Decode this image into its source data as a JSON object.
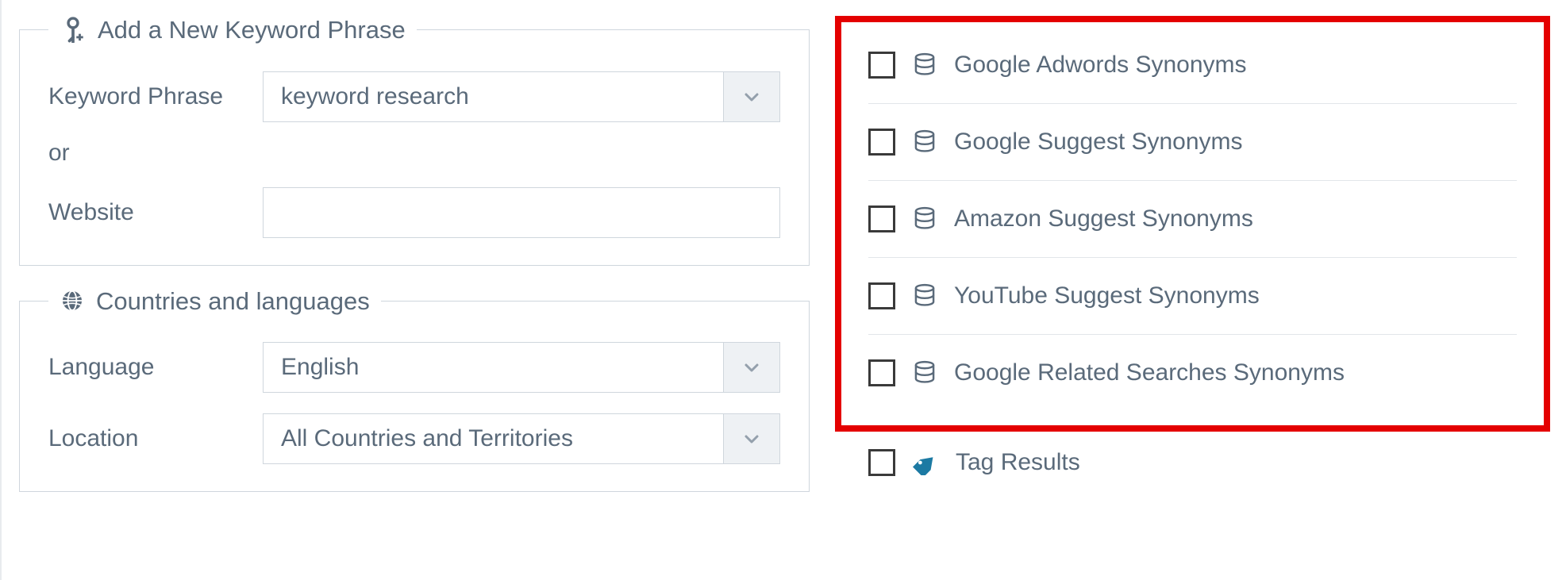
{
  "keyword_panel": {
    "legend": "Add a New Keyword Phrase",
    "keyword_label": "Keyword Phrase",
    "keyword_value": "keyword research",
    "or_label": "or",
    "website_label": "Website",
    "website_value": ""
  },
  "locale_panel": {
    "legend": "Countries and languages",
    "language_label": "Language",
    "language_value": "English",
    "location_label": "Location",
    "location_value": "All Countries and Territories"
  },
  "synonym_sources": [
    {
      "label": "Google Adwords Synonyms",
      "checked": false
    },
    {
      "label": "Google Suggest Synonyms",
      "checked": false
    },
    {
      "label": "Amazon Suggest Synonyms",
      "checked": false
    },
    {
      "label": "YouTube Suggest Synonyms",
      "checked": false
    },
    {
      "label": "Google Related Searches Synonyms",
      "checked": false
    }
  ],
  "tag_results": {
    "label": "Tag Results",
    "checked": false
  }
}
